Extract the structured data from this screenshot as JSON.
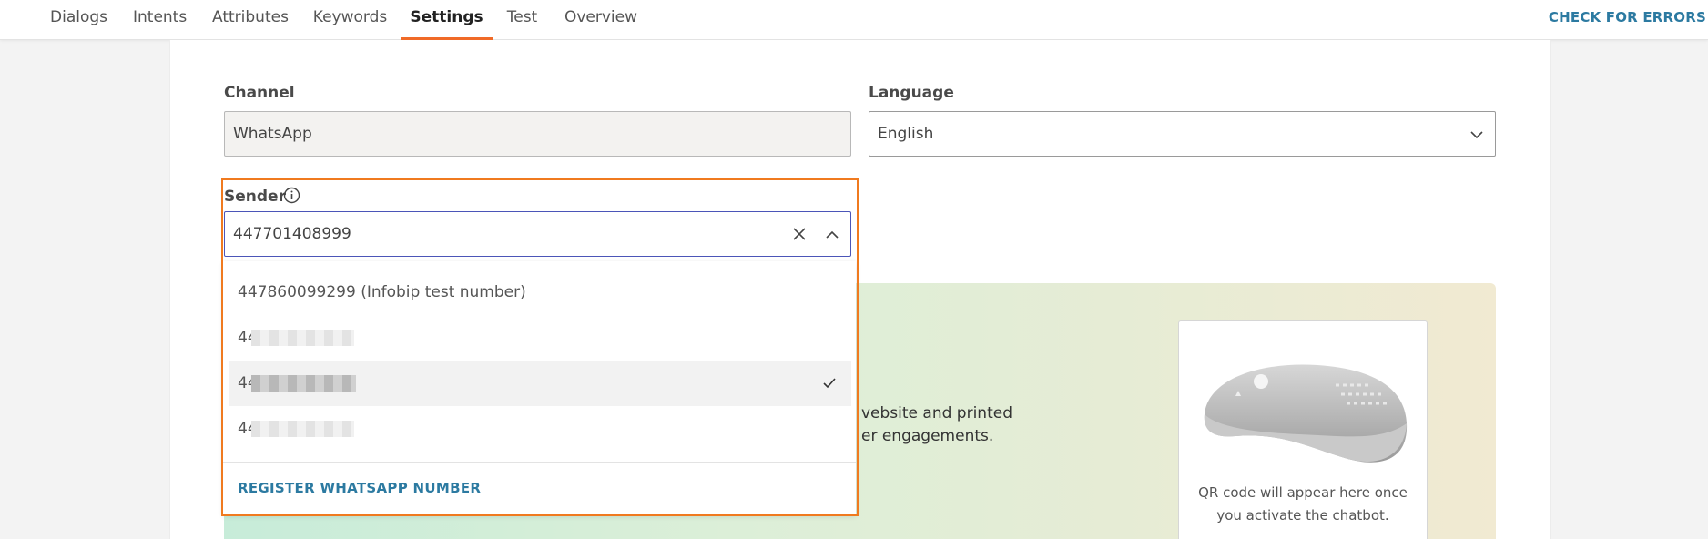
{
  "nav": {
    "tabs": [
      {
        "label": "Dialogs"
      },
      {
        "label": "Intents"
      },
      {
        "label": "Attributes"
      },
      {
        "label": "Keywords"
      },
      {
        "label": "Settings"
      },
      {
        "label": "Test"
      },
      {
        "label": "Overview"
      }
    ],
    "active_tab": "Settings",
    "check_errors_label": "CHECK FOR ERRORS"
  },
  "form": {
    "channel": {
      "label": "Channel",
      "value": "WhatsApp"
    },
    "language": {
      "label": "Language",
      "value": "English"
    },
    "sender": {
      "label": "Sender",
      "value": "447701408999",
      "options": [
        {
          "label": "447860099299 (Infobip test number)"
        },
        {
          "label": "44"
        },
        {
          "label": "44",
          "selected": true
        },
        {
          "label": "44"
        }
      ],
      "register_label": "REGISTER WHATSAPP NUMBER"
    }
  },
  "banner": {
    "line1": "vebsite and printed",
    "line2": "er engagements.",
    "qr_text_line1": "QR code will appear here once",
    "qr_text_line2": "you activate the chatbot."
  },
  "colors": {
    "accent": "#f06a27",
    "link": "#2c7aa1",
    "focus_border": "#4b55b8"
  }
}
